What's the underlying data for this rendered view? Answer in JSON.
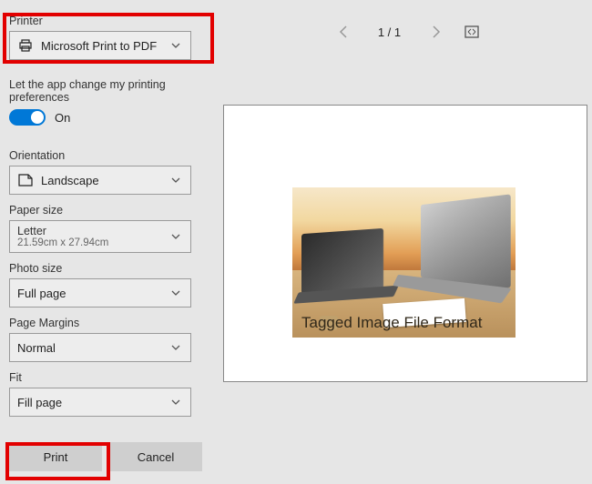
{
  "labels": {
    "printer": "Printer",
    "permissions": "Let the app change my printing preferences",
    "toggle_on": "On",
    "orientation": "Orientation",
    "paper_size": "Paper size",
    "photo_size": "Photo size",
    "page_margins": "Page Margins",
    "fit": "Fit"
  },
  "dropdowns": {
    "printer": "Microsoft Print to PDF",
    "orientation": "Landscape",
    "paper_size_line1": "Letter",
    "paper_size_line2": "21.59cm x 27.94cm",
    "photo_size": "Full page",
    "page_margins": "Normal",
    "fit": "Fill page"
  },
  "buttons": {
    "print": "Print",
    "cancel": "Cancel"
  },
  "nav": {
    "page_indicator": "1 / 1"
  },
  "preview": {
    "caption": "Tagged Image File Format"
  }
}
